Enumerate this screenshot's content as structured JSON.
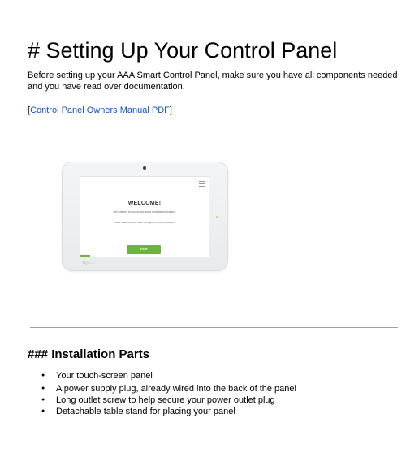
{
  "doc": {
    "title": "# Setting Up Your Control Panel",
    "intro": "Before setting up your AAA Smart Control Panel, make sure you have all components needed and you have read over documentation.",
    "manual_link": {
      "open_bracket": "[",
      "text": "Control Panel Owners Manual PDF",
      "close_bracket": "]"
    },
    "device_image": {
      "welcome_title": "WELCOME!",
      "welcome_sub": "Get started by using our easy installation wizard.",
      "welcome_note": "Please make sure your panel is plugged in before proceeding.",
      "start_button": "START",
      "logo": "IQ",
      "logo_suffix": "panel",
      "icon": "hamburger-menu-icon",
      "accent_color": "#6cb33f"
    },
    "section": {
      "heading": "### Installation Parts",
      "items": [
        "Your touch-screen panel",
        "A power supply plug, already wired into the back of the panel",
        "Long outlet screw to help secure your power outlet plug",
        "Detachable table stand for placing your panel"
      ]
    },
    "colors": {
      "link": "#1155cc",
      "divider": "#a0a0a0"
    }
  }
}
